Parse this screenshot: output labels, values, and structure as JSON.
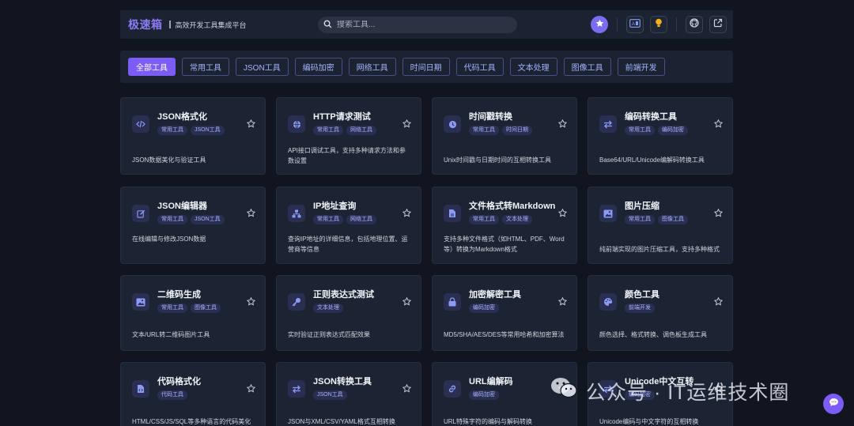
{
  "header": {
    "brand": "极速箱",
    "tagline": "高效开发工具集成平台",
    "search_placeholder": "搜索工具..."
  },
  "filters": [
    "全部工具",
    "常用工具",
    "JSON工具",
    "编码加密",
    "网络工具",
    "时间日期",
    "代码工具",
    "文本处理",
    "图像工具",
    "前端开发"
  ],
  "active_filter": "全部工具",
  "cards": [
    {
      "title": "JSON格式化",
      "tags": [
        "常用工具",
        "JSON工具"
      ],
      "desc": "JSON数据美化与验证工具",
      "icon": "code-icon"
    },
    {
      "title": "HTTP请求测试",
      "tags": [
        "常用工具",
        "网络工具"
      ],
      "desc": "API接口调试工具，支持多种请求方法和参数设置",
      "icon": "globe-icon"
    },
    {
      "title": "时间戳转换",
      "tags": [
        "常用工具",
        "时间日期"
      ],
      "desc": "Unix时间戳与日期时间的互相转换工具",
      "icon": "clock-icon"
    },
    {
      "title": "编码转换工具",
      "tags": [
        "常用工具",
        "编码加密"
      ],
      "desc": "Base64/URL/Unicode编解码转换工具",
      "icon": "exchange-icon"
    },
    {
      "title": "JSON编辑器",
      "tags": [
        "常用工具",
        "JSON工具"
      ],
      "desc": "在线编辑与修改JSON数据",
      "icon": "edit-icon"
    },
    {
      "title": "IP地址查询",
      "tags": [
        "常用工具",
        "网络工具"
      ],
      "desc": "查询IP地址的详细信息，包括地理位置、运营商等信息",
      "icon": "network-icon"
    },
    {
      "title": "文件格式转Markdown",
      "tags": [
        "常用工具",
        "文本处理"
      ],
      "desc": "支持多种文件格式（如HTML、PDF、Word等）转换为Markdown格式",
      "icon": "file-icon"
    },
    {
      "title": "图片压缩",
      "tags": [
        "常用工具",
        "图像工具"
      ],
      "desc": "纯前端实现的图片压缩工具，支持多种格式",
      "icon": "image-icon"
    },
    {
      "title": "二维码生成",
      "tags": [
        "常用工具",
        "图像工具"
      ],
      "desc": "文本/URL转二维码图片工具",
      "icon": "image-icon"
    },
    {
      "title": "正则表达式测试",
      "tags": [
        "文本处理"
      ],
      "desc": "实时验证正则表达式匹配效果",
      "icon": "key-icon"
    },
    {
      "title": "加密解密工具",
      "tags": [
        "编码加密"
      ],
      "desc": "MD5/SHA/AES/DES等常用哈希和加密算法",
      "icon": "lock-icon"
    },
    {
      "title": "颜色工具",
      "tags": [
        "前端开发"
      ],
      "desc": "颜色选择、格式转换、调色板生成工具",
      "icon": "palette-icon"
    },
    {
      "title": "代码格式化",
      "tags": [
        "代码工具"
      ],
      "desc": "HTML/CSS/JS/SQL等多种语言的代码美化",
      "icon": "file-code-icon"
    },
    {
      "title": "JSON转换工具",
      "tags": [
        "JSON工具"
      ],
      "desc": "JSON与XML/CSV/YAML格式互相转换",
      "icon": "exchange-icon"
    },
    {
      "title": "URL编解码",
      "tags": [
        "编码加密"
      ],
      "desc": "URL特殊字符的编码与解码转换",
      "icon": "link-icon"
    },
    {
      "title": "Unicode中文互转",
      "tags": [
        "编码加密"
      ],
      "desc": "Unicode编码与中文字符的互相转换",
      "icon": "exchange-icon"
    }
  ],
  "watermark": "公众号 · IT运维技术圈",
  "colors": {
    "accent": "#7c5cf6",
    "background": "#101520",
    "card": "#1c2333"
  }
}
